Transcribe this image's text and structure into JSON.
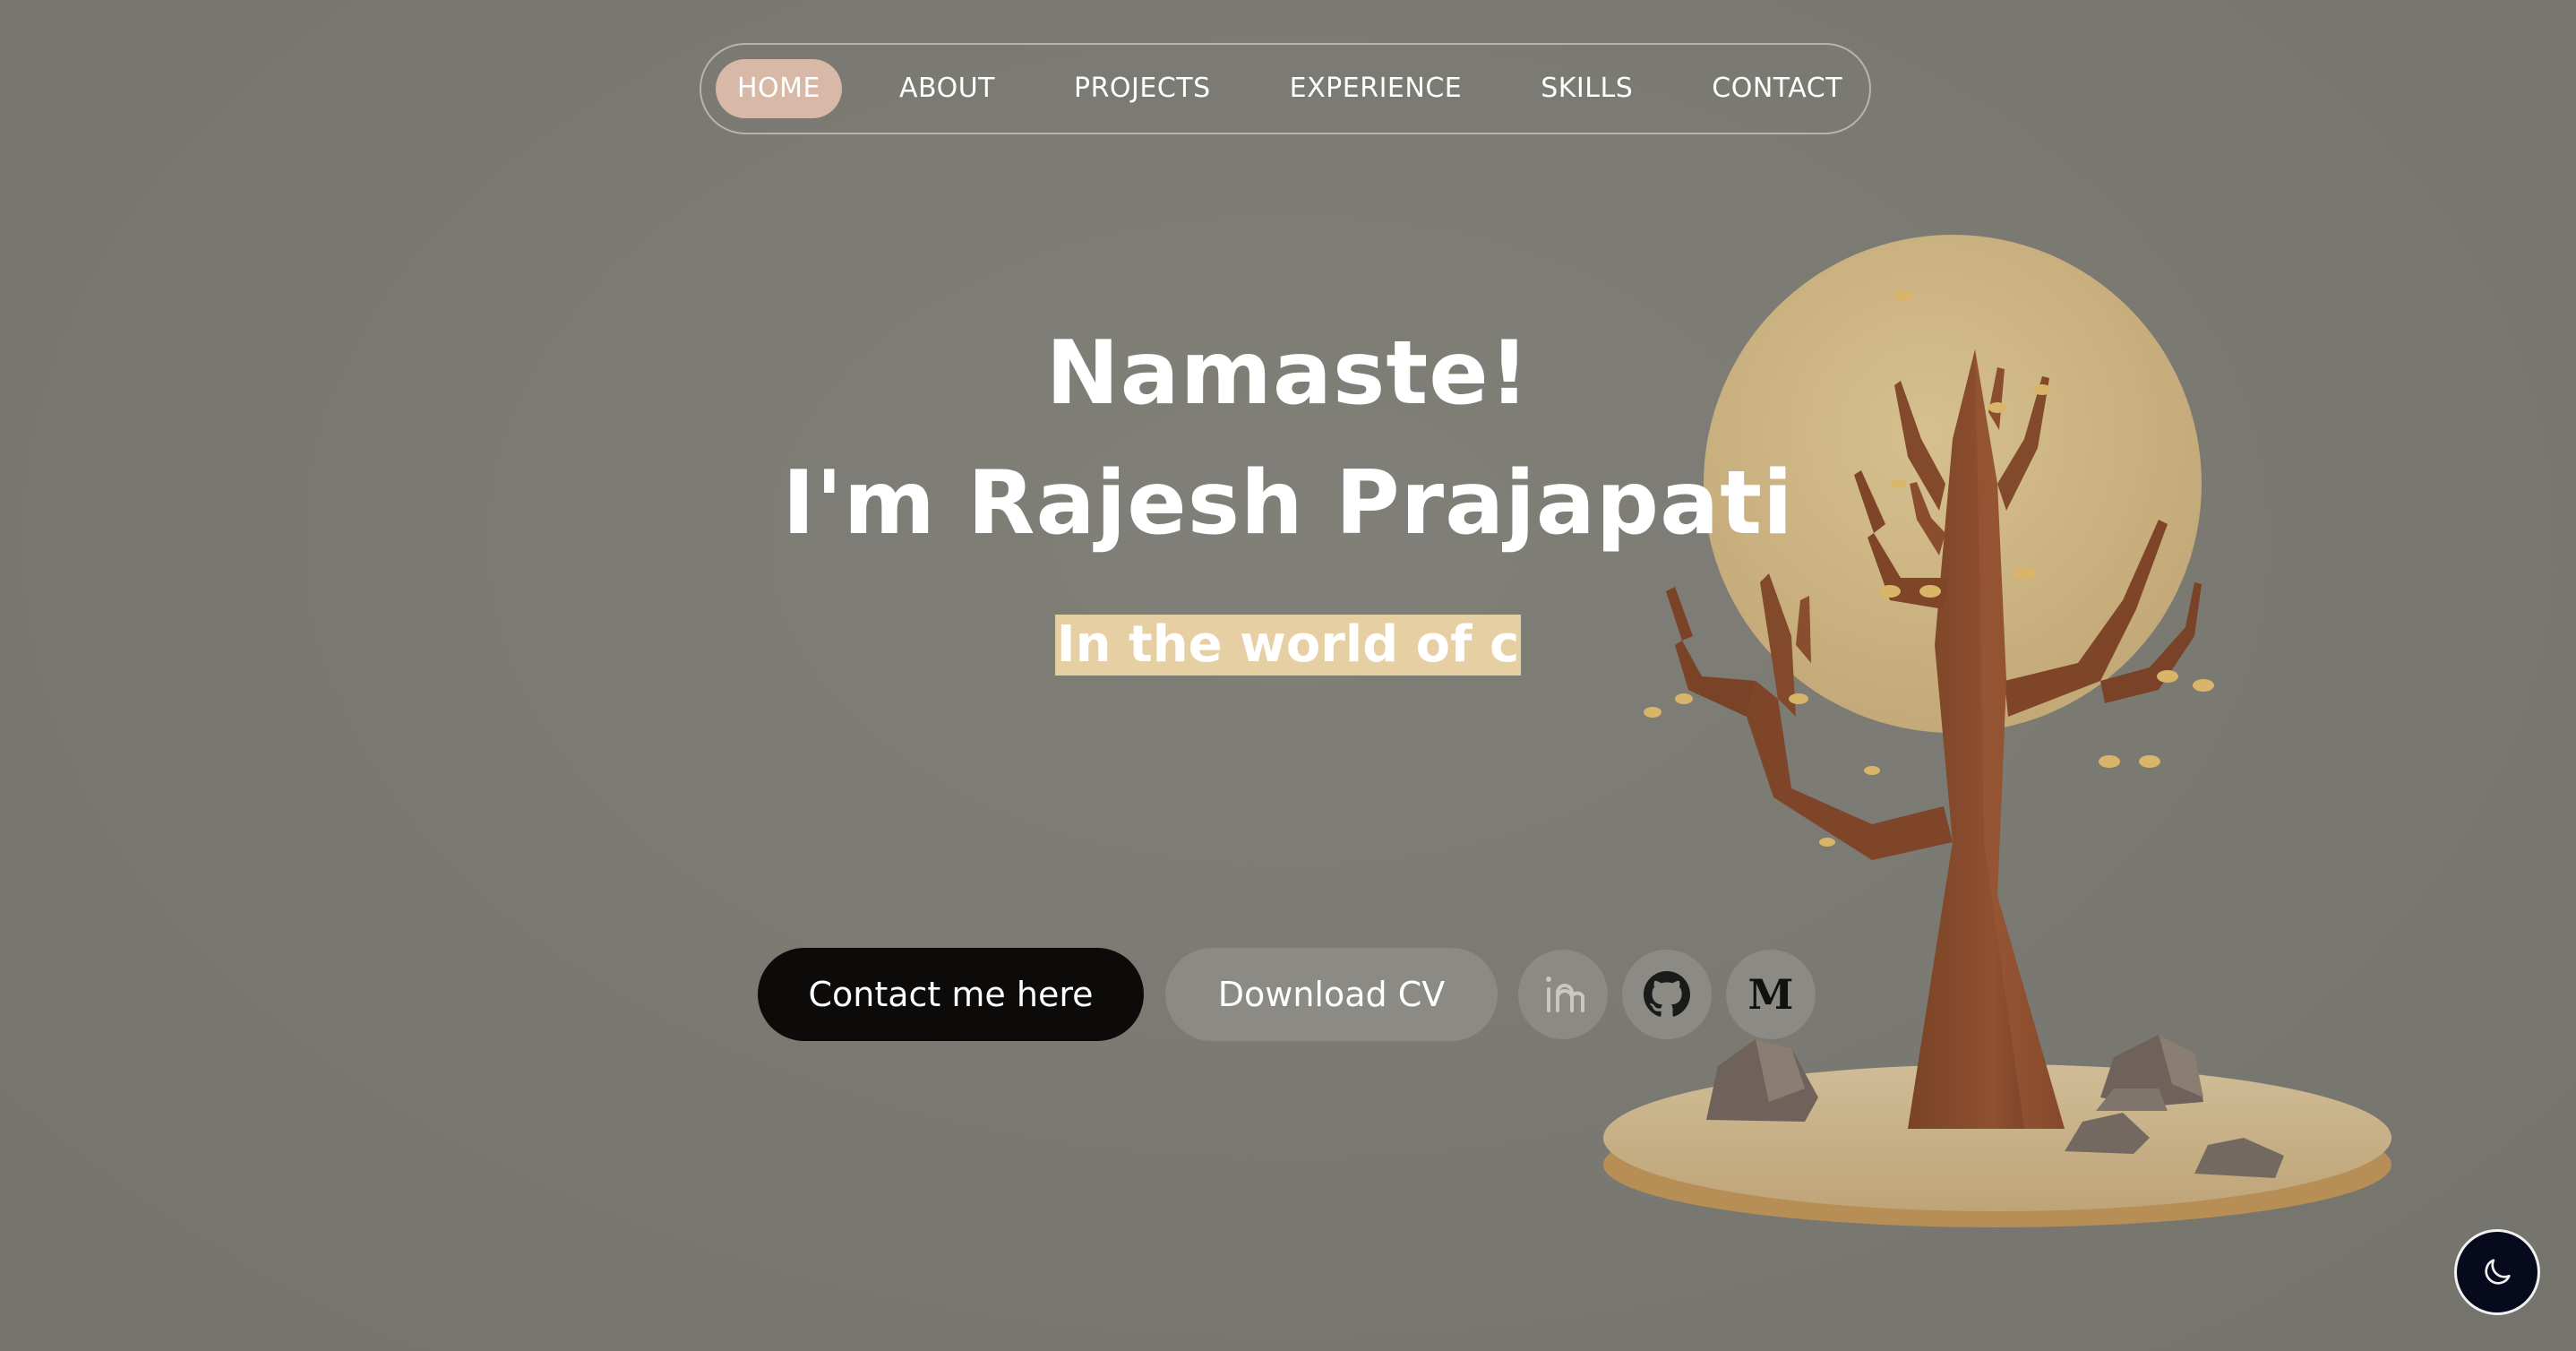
{
  "nav": {
    "items": [
      {
        "label": "HOME",
        "active": true
      },
      {
        "label": "ABOUT",
        "active": false
      },
      {
        "label": "PROJECTS",
        "active": false
      },
      {
        "label": "EXPERIENCE",
        "active": false
      },
      {
        "label": "SKILLS",
        "active": false
      },
      {
        "label": "CONTACT",
        "active": false
      }
    ]
  },
  "hero": {
    "greeting": "Namaste!",
    "name_line": "I'm Rajesh Prajapati",
    "typewriter_text": "In the world of c"
  },
  "actions": {
    "contact_label": "Contact me here",
    "download_cv_label": "Download CV"
  },
  "socials": [
    {
      "icon": "linkedin-icon"
    },
    {
      "icon": "github-icon"
    },
    {
      "icon": "medium-icon",
      "glyph": "M"
    }
  ],
  "theme_toggle": {
    "icon": "moon-icon"
  },
  "colors": {
    "background": "#7b7a73",
    "nav_active": "#d8b8a6",
    "typewriter_highlight": "#e6cfa3",
    "contact_button": "#0d0b09",
    "secondary_button": "#8b8a84",
    "theme_toggle": "#070a1c"
  }
}
